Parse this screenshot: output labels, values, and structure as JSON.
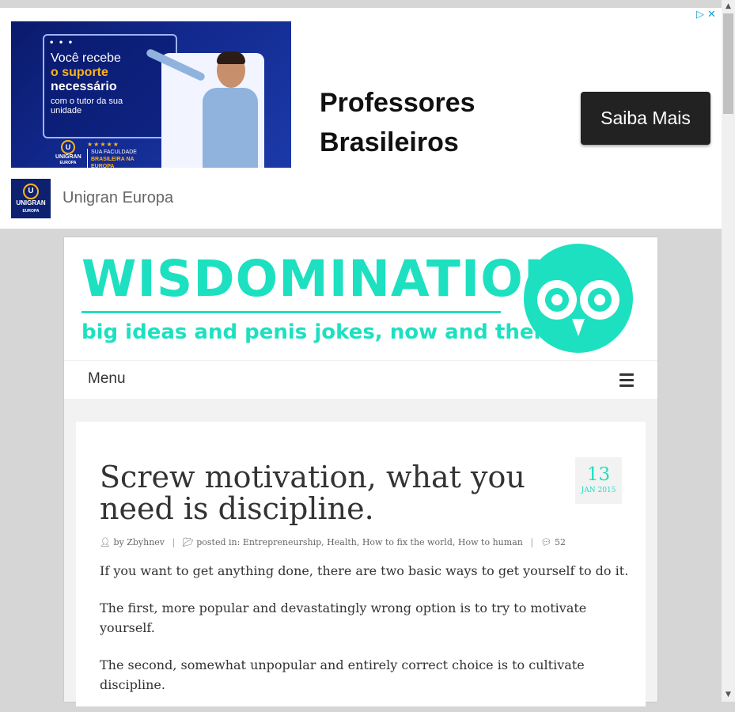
{
  "ad": {
    "image_lines": [
      "Você recebe",
      "o suporte",
      "necessário",
      "com o tutor da sua unidade"
    ],
    "image_logo": "UNIGRAN",
    "image_logo_sub": "EUROPA",
    "image_stars": "★★★★★",
    "image_tag_1": "SUA FACULDADE",
    "image_tag_2": "BRASILEIRA NA EUROPA",
    "headline_1": "Professores",
    "headline_2": "Brasileiros",
    "cta": "Saiba Mais",
    "advertiser_logo": "UNIGRAN",
    "advertiser_logo_sub": "EUROPA",
    "advertiser_name": "Unigran Europa",
    "adchoices": "▷✕"
  },
  "site": {
    "logo_title": "WISDOMINATION",
    "logo_tagline": "big ideas and penis jokes, now and then",
    "menu_label": "Menu"
  },
  "post": {
    "title": "Screw motivation, what you need is discipline.",
    "date_day": "13",
    "date_month": "JAN 2015",
    "meta": {
      "author_prefix": "by",
      "author": "Zbyhnev",
      "posted_in": "posted in:",
      "categories": [
        "Entrepreneurship",
        "Health",
        "How to fix the world",
        "How to human"
      ],
      "comments": "52"
    },
    "paragraphs": [
      "If you want to get anything done, there are two basic ways to get yourself to do it.",
      "The first, more popular and devastatingly wrong option is to try to motivate yourself.",
      "The second, somewhat unpopular and entirely correct choice is to cultivate discipline."
    ]
  },
  "colors": {
    "accent": "#1de0c0",
    "background": "#d6d6d6",
    "cta": "#222222"
  }
}
